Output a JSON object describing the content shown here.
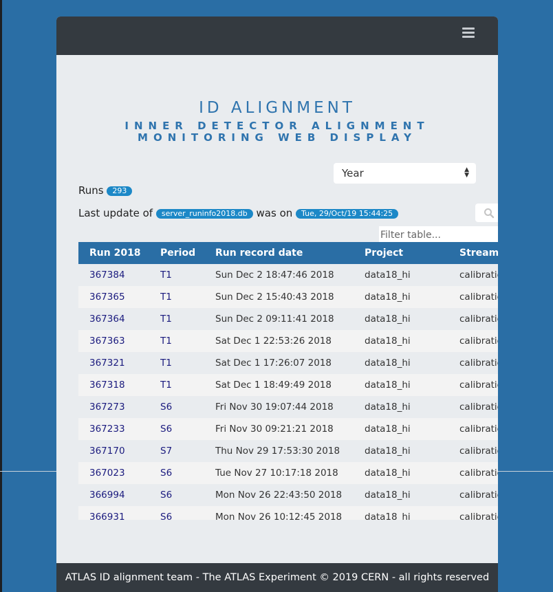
{
  "header": {
    "menu_icon": "hamburger-menu-icon"
  },
  "title": {
    "main": "ID ALIGNMENT",
    "sub_line1": "INNER DETECTOR ALIGNMENT",
    "sub_line2": "MONITORING WEB DISPLAY"
  },
  "year_select": {
    "selected": "Year"
  },
  "runs": {
    "label": "Runs",
    "count": "293"
  },
  "update": {
    "prefix": "Last update of",
    "db": "server_runinfo2018.db",
    "middle": "was on",
    "date": "Tue, 29/Oct/19 15:44:25"
  },
  "search": {
    "icon": "search-icon",
    "placeholder": "Filter table..."
  },
  "table": {
    "columns": [
      "Run 2018",
      "Period",
      "Run record date",
      "Project",
      "Stream"
    ],
    "rows": [
      [
        "367384",
        "T1",
        "Sun Dec 2 18:47:46 2018",
        "data18_hi",
        "calibratic"
      ],
      [
        "367365",
        "T1",
        "Sun Dec 2 15:40:43 2018",
        "data18_hi",
        "calibratic"
      ],
      [
        "367364",
        "T1",
        "Sun Dec 2 09:11:41 2018",
        "data18_hi",
        "calibratic"
      ],
      [
        "367363",
        "T1",
        "Sat Dec 1 22:53:26 2018",
        "data18_hi",
        "calibratic"
      ],
      [
        "367321",
        "T1",
        "Sat Dec 1 17:26:07 2018",
        "data18_hi",
        "calibratic"
      ],
      [
        "367318",
        "T1",
        "Sat Dec 1 18:49:49 2018",
        "data18_hi",
        "calibratic"
      ],
      [
        "367273",
        "S6",
        "Fri Nov 30 19:07:44 2018",
        "data18_hi",
        "calibratic"
      ],
      [
        "367233",
        "S6",
        "Fri Nov 30 09:21:21 2018",
        "data18_hi",
        "calibratic"
      ],
      [
        "367170",
        "S7",
        "Thu Nov 29 17:53:30 2018",
        "data18_hi",
        "calibratic"
      ],
      [
        "367023",
        "S6",
        "Tue Nov 27 10:17:18 2018",
        "data18_hi",
        "calibratic"
      ],
      [
        "366994",
        "S6",
        "Mon Nov 26 22:43:50 2018",
        "data18_hi",
        "calibratic"
      ],
      [
        "366931",
        "S6",
        "Mon Nov 26 10:12:45 2018",
        "data18_hi",
        "calibratic"
      ]
    ]
  },
  "footer": {
    "text": "ATLAS ID alignment team - The ATLAS Experiment © 2019 CERN - all rights reserved"
  },
  "colors": {
    "navbar": "#343a40",
    "accent": "#2a6ea5",
    "badge": "#1c88c7",
    "title": "#2f74ae",
    "link": "#1a1a7e"
  }
}
